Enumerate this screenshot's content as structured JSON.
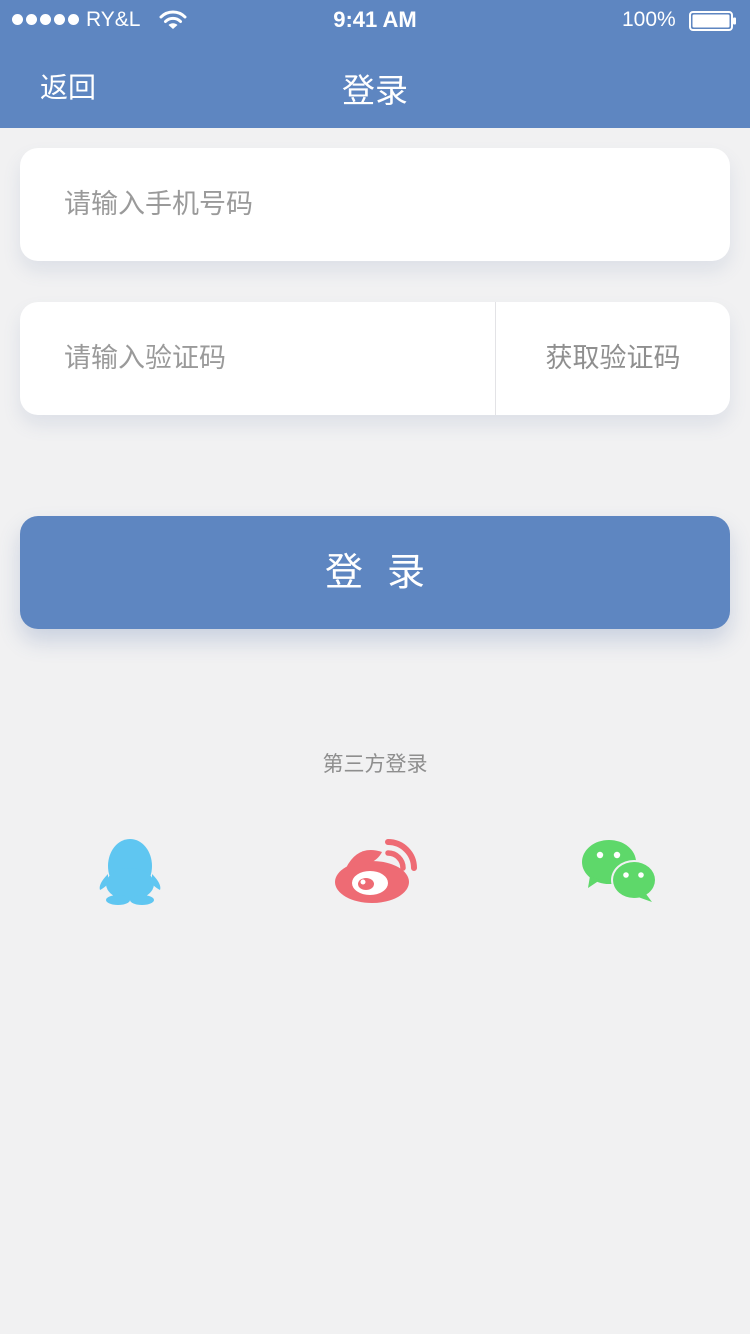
{
  "status_bar": {
    "carrier": "RY&L",
    "time": "9:41 AM",
    "battery": "100%"
  },
  "nav": {
    "back_label": "返回",
    "title": "登录"
  },
  "form": {
    "phone_placeholder": "请输入手机号码",
    "code_placeholder": "请输入验证码",
    "get_code_label": "获取验证码",
    "login_label": "登录"
  },
  "third_party": {
    "label": "第三方登录",
    "providers": [
      {
        "icon": "qq-icon",
        "color": "#5fc6f1"
      },
      {
        "icon": "weibo-icon",
        "color": "#ee6b74"
      },
      {
        "icon": "wechat-icon",
        "color": "#5ed86a"
      }
    ]
  },
  "colors": {
    "brand": "#5e86c1",
    "background": "#f1f1f2"
  }
}
